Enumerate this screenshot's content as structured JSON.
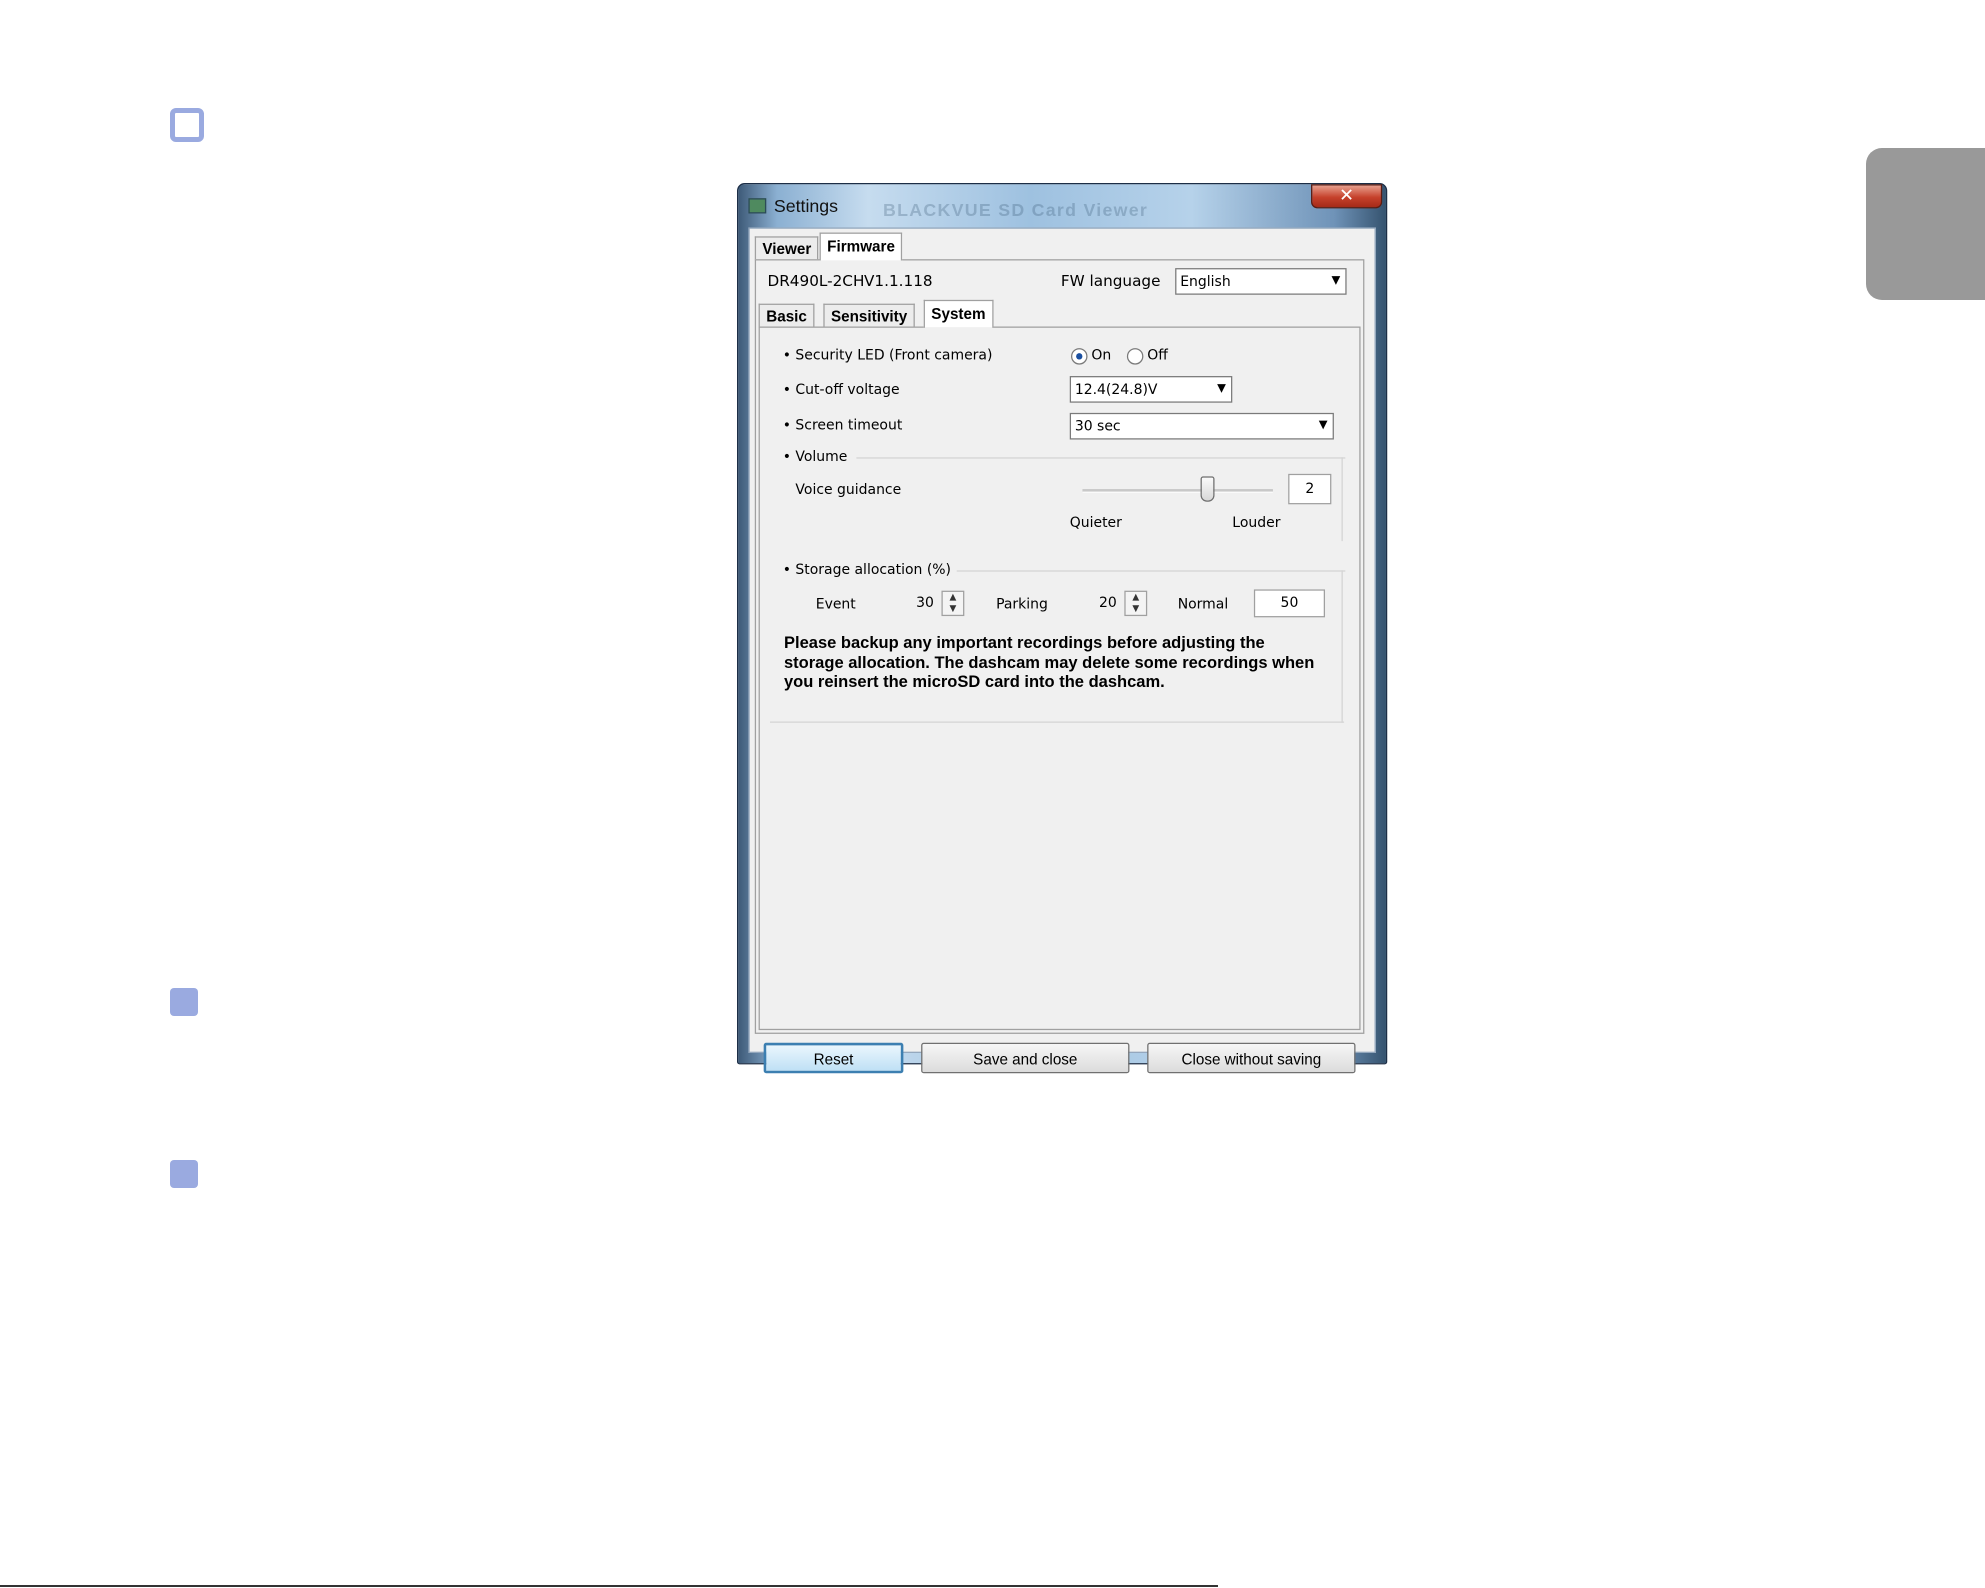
{
  "window": {
    "title": "Settings",
    "background_title": "BLACKVUE SD Card Viewer",
    "close_glyph": "✕"
  },
  "top_tabs": [
    {
      "label": "Viewer",
      "active": false
    },
    {
      "label": "Firmware",
      "active": true
    }
  ],
  "firmware": {
    "model": "DR490L-2CH",
    "version": "V1.1.118",
    "fw_language_label": "FW language",
    "fw_language_value": "English"
  },
  "sub_tabs": [
    {
      "label": "Basic",
      "active": false
    },
    {
      "label": "Sensitivity",
      "active": false
    },
    {
      "label": "System",
      "active": true
    }
  ],
  "system": {
    "security_led": {
      "label": "• Security LED (Front camera)",
      "on_label": "On",
      "off_label": "Off",
      "selected": "On"
    },
    "cutoff_voltage": {
      "label": "• Cut-off voltage",
      "value": "12.4(24.8)V"
    },
    "screen_timeout": {
      "label": "• Screen timeout",
      "value": "30 sec"
    },
    "volume": {
      "label": "• Volume",
      "voice_guidance_label": "Voice guidance",
      "value": "2",
      "min_label": "Quieter",
      "max_label": "Louder",
      "level_fraction": 0.65
    },
    "storage": {
      "label": "• Storage allocation (%)",
      "event_label": "Event",
      "event_value": "30",
      "parking_label": "Parking",
      "parking_value": "20",
      "normal_label": "Normal",
      "normal_value": "50",
      "warning": "Please backup any important recordings before adjusting the storage allocation. The dashcam may delete some recordings when you reinsert the microSD card into the dashcam."
    }
  },
  "buttons": {
    "reset": "Reset",
    "save_close": "Save and close",
    "close_no_save": "Close without saving"
  },
  "icons": {
    "dropdown": "▼",
    "spin_up": "▲",
    "spin_down": "▼"
  },
  "colors": {
    "page_marker": "#9aaae0",
    "side_tab": "#999999"
  }
}
